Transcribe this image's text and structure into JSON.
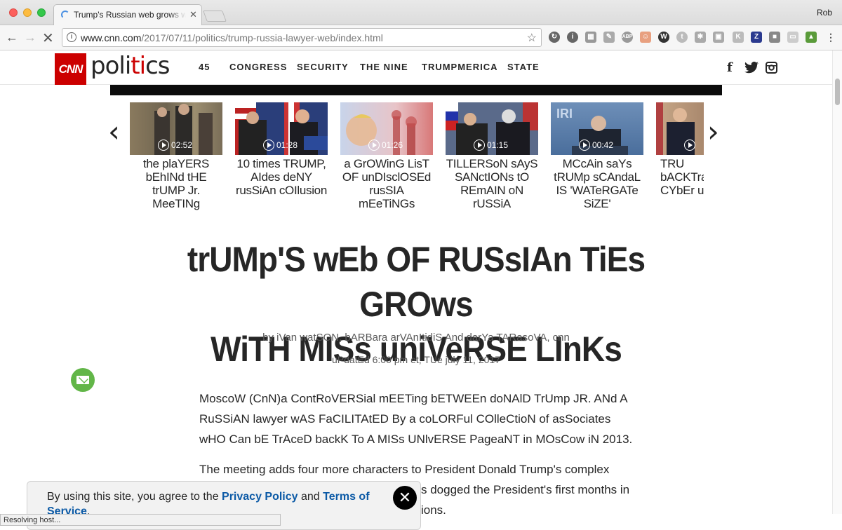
{
  "browser": {
    "tab_title": "Trump's Russian web grows with Miss Universe links",
    "user_name": "Rob",
    "url_host": "www.cnn.com",
    "url_path": "/2017/07/11/politics/trump-russia-lawyer-web/index.html",
    "status_text": "Resolving host..."
  },
  "header": {
    "logo_text": "CNN",
    "section_text_a": "poli",
    "section_text_b": "ti",
    "section_text_c": "cs",
    "nav": [
      "45",
      "CONGRESS",
      "SECURITY",
      "THE NINE",
      "TRUMPMERICA",
      "STATE"
    ],
    "social": {
      "facebook": "f",
      "twitter": "t",
      "instagram": "i"
    }
  },
  "videos": [
    {
      "duration": "02:52",
      "title": "the plaYERS bEhINd tHE trUMP Jr. MeeTINg"
    },
    {
      "duration": "01:28",
      "title": "10 times TRUMP, AIdes deNY rusSiAn cOIlusion"
    },
    {
      "duration": "01:26",
      "title": "a GrOWinG LisT OF unDIsclOSEd rusSIA mEeTiNGs"
    },
    {
      "duration": "01:15",
      "title": "TILLERSoN sAyS SANctIONs tO REmAIN oN rUSSiA"
    },
    {
      "duration": "00:42",
      "title": "MCcAin saYs tRUMp sCAndaL IS 'WATeRGATe SiZE'"
    },
    {
      "duration": "",
      "title": "TRU bACKTra CYbEr u rUs"
    }
  ],
  "article": {
    "headline_1": "trUMp'S wEb OF RUSsIAn TiEs GROws",
    "headline_2": "WiTH MISs uniVeRSE LInKs",
    "byline": "by iVan watSON, bARBara arVAnItidiS And darYa TARasoVA, cnn",
    "updated": "uPdatEd 6:00 pm et, TUe july 11, 2017",
    "para1": "MoscoW (CnN)a ContRoVERSial mEETing bETWEEn doNAlD TrUmp JR. ANd A RuSSiAN lawyer wAS FaCILITAtED By a coLORFul COlleCtioN of asSociates wHO Can bE TrAceD backK To A MISs UNlvERSE PageaNT in MOsCow iN 2013.",
    "para2": "The meeting adds four more characters to President Donald Trump's complex",
    "para3": "s dogged the President's first months in",
    "para4": "ions."
  },
  "cookie": {
    "text_a": "By using this site, you agree to the ",
    "privacy": "Privacy Policy",
    "text_b": " and ",
    "terms": "Terms of Service",
    "text_c": "."
  }
}
